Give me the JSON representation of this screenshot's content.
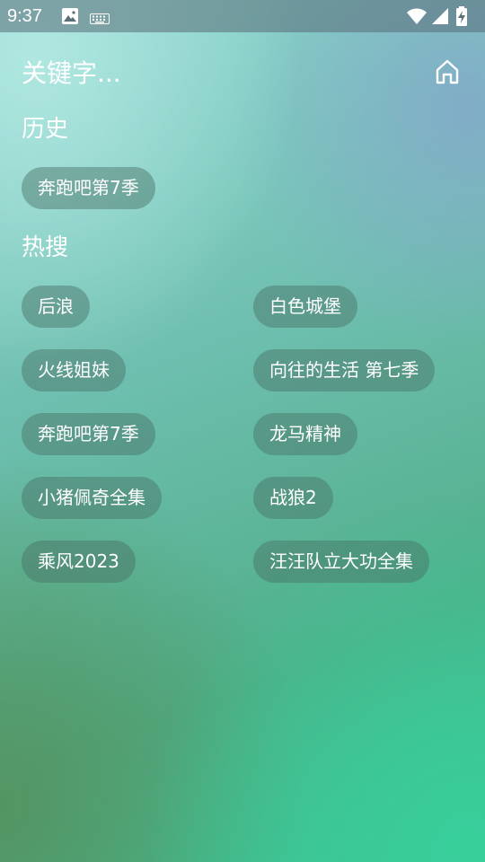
{
  "status_bar": {
    "time": "9:37",
    "left_icons": [
      "image-icon",
      "keyboard-icon"
    ],
    "right_icons": [
      "wifi-icon",
      "signal-icon",
      "battery-charging-icon"
    ]
  },
  "header": {
    "title": "关键字...",
    "home_icon": "home-icon"
  },
  "history": {
    "title": "历史",
    "items": [
      "奔跑吧第7季"
    ]
  },
  "hot": {
    "title": "热搜",
    "items": [
      "后浪",
      "白色城堡",
      "火线姐妹",
      "向往的生活 第七季",
      "奔跑吧第7季",
      "龙马精神",
      "小猪佩奇全集",
      "战狼2",
      "乘风2023",
      "汪汪队立大功全集"
    ]
  }
}
